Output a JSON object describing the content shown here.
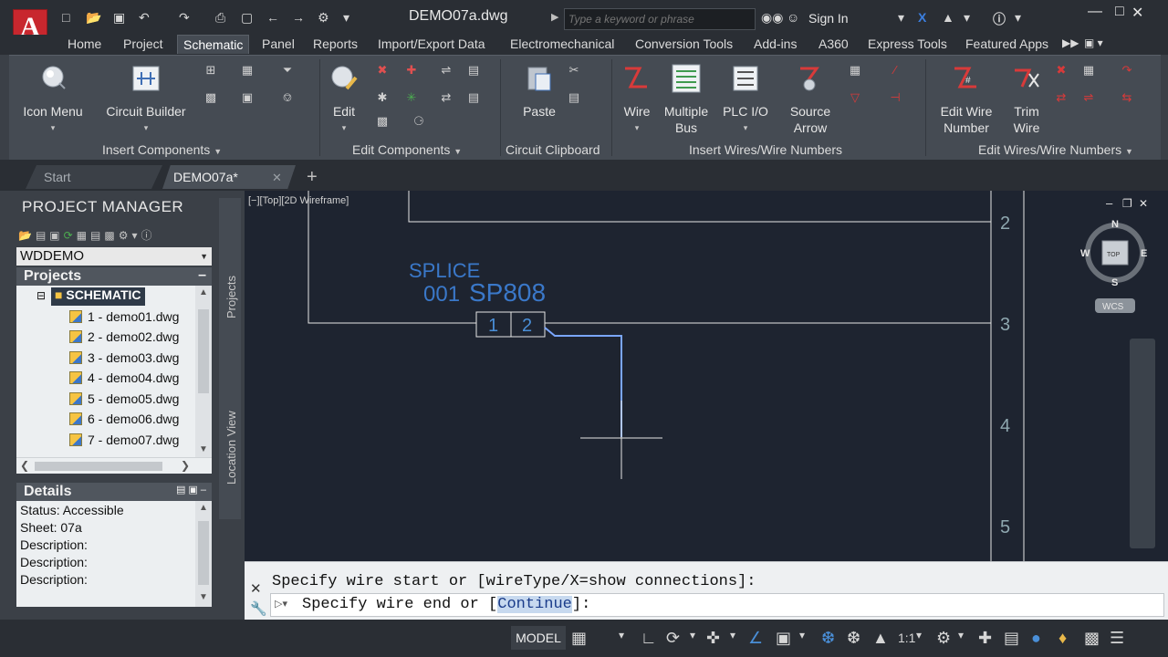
{
  "window": {
    "title": "DEMO07a.dwg",
    "search_placeholder": "Type a keyword or phrase",
    "sign_in": "Sign In"
  },
  "ribbon_tabs": [
    "Home",
    "Project",
    "Schematic",
    "Panel",
    "Reports",
    "Import/Export Data",
    "Electromechanical",
    "Conversion Tools",
    "Add-ins",
    "A360",
    "Express Tools",
    "Featured Apps"
  ],
  "active_tab": "Schematic",
  "ribbon": {
    "icon_menu": "Icon Menu",
    "circuit_builder": "Circuit Builder",
    "edit": "Edit",
    "paste": "Paste",
    "wire": "Wire",
    "multiple_bus_1": "Multiple",
    "multiple_bus_2": "Bus",
    "plc_io": "PLC I/O",
    "source_arrow_1": "Source",
    "source_arrow_2": "Arrow",
    "edit_wire_number_1": "Edit Wire",
    "edit_wire_number_2": "Number",
    "trim_wire_1": "Trim",
    "trim_wire_2": "Wire",
    "panels": {
      "insert_components": "Insert Components",
      "edit_components": "Edit Components",
      "circuit_clipboard": "Circuit Clipboard",
      "insert_wires": "Insert Wires/Wire Numbers",
      "edit_wires": "Edit Wires/Wire Numbers"
    }
  },
  "doc_tabs": {
    "start": "Start",
    "active": "DEMO07a*"
  },
  "project_manager": {
    "title": "PROJECT MANAGER",
    "project": "WDDEMO",
    "projects_header": "Projects",
    "folder": "SCHEMATIC",
    "files": [
      "1 - demo01.dwg",
      "2 - demo02.dwg",
      "3 - demo03.dwg",
      "4 - demo04.dwg",
      "5 - demo05.dwg",
      "6 - demo06.dwg",
      "7 - demo07.dwg"
    ],
    "details_header": "Details",
    "details": [
      "Status: Accessible",
      "Sheet: 07a",
      "Description:",
      "Description:",
      "Description:"
    ],
    "side_tabs": [
      "Projects",
      "Location View"
    ]
  },
  "drawing": {
    "viewport_label": "[−][Top][2D Wireframe]",
    "splice_label": "SPLICE",
    "splice_num": "001",
    "splice_tag": "SP808",
    "pin1": "1",
    "pin2": "2",
    "ladder_refs": [
      "2",
      "3",
      "4",
      "5"
    ],
    "viewcube": {
      "top": "TOP",
      "n": "N",
      "s": "S",
      "e": "E",
      "w": "W",
      "wcs": "WCS"
    }
  },
  "command_line": {
    "history": "Specify wire start or [wireType/X=show connections]:",
    "prompt_prefix": "Specify wire end or [",
    "prompt_option": "Continue",
    "prompt_suffix": "]:"
  },
  "status_bar": {
    "model": "MODEL",
    "scale": "1:1"
  }
}
